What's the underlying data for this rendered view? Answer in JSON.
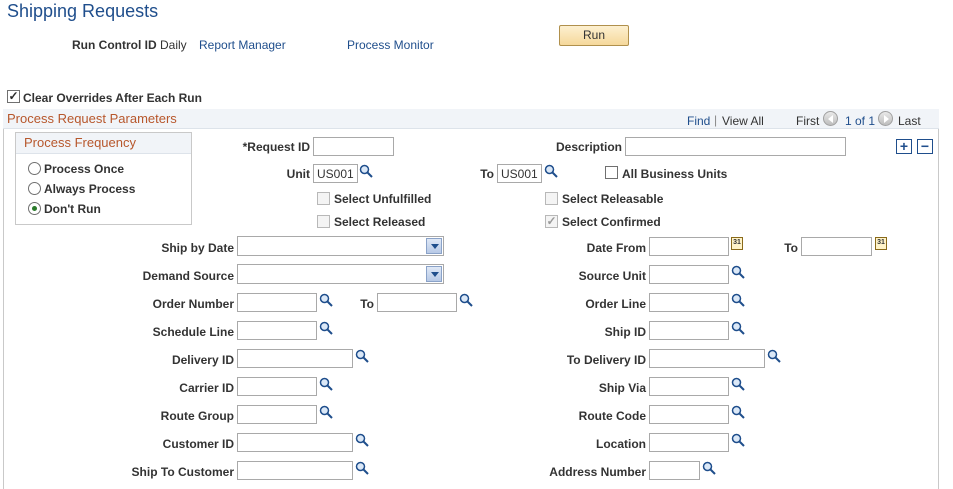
{
  "page": {
    "title": "Shipping Requests",
    "run_control_label": "Run Control ID",
    "run_control_value": "Daily",
    "report_manager": "Report Manager",
    "process_monitor": "Process Monitor",
    "run_button": "Run"
  },
  "clear_overrides": {
    "label": "Clear Overrides After Each Run",
    "checked": true
  },
  "params": {
    "title": "Process Request Parameters",
    "find": "Find",
    "view_all": "View All",
    "first": "First",
    "range": "1 of 1",
    "last": "Last",
    "add_icon": "plus-icon",
    "remove_icon": "minus-icon"
  },
  "frequency": {
    "title": "Process Frequency",
    "options": [
      "Process Once",
      "Always Process",
      "Don't Run"
    ],
    "selected": "Don't Run"
  },
  "fields": {
    "request_id": {
      "label": "*Request ID",
      "value": ""
    },
    "description": {
      "label": "Description",
      "value": ""
    },
    "unit": {
      "label": "Unit",
      "value": "US001"
    },
    "unit_to": {
      "label": "To",
      "value": "US001"
    },
    "all_business_units": {
      "label": "All Business Units",
      "checked": false
    },
    "select_unfulfilled": {
      "label": "Select Unfulfilled",
      "checked": false
    },
    "select_releasable": {
      "label": "Select Releasable",
      "checked": false
    },
    "select_released": {
      "label": "Select Released",
      "checked": false
    },
    "select_confirmed": {
      "label": "Select Confirmed",
      "checked": true
    },
    "ship_by_date": {
      "label": "Ship by Date",
      "value": ""
    },
    "date_from": {
      "label": "Date From",
      "value": ""
    },
    "date_to": {
      "label": "To",
      "value": ""
    },
    "demand_source": {
      "label": "Demand Source",
      "value": ""
    },
    "source_unit": {
      "label": "Source Unit",
      "value": ""
    },
    "order_number": {
      "label": "Order Number",
      "value": ""
    },
    "order_number_to": {
      "label": "To",
      "value": ""
    },
    "order_line": {
      "label": "Order Line",
      "value": ""
    },
    "schedule_line": {
      "label": "Schedule Line",
      "value": ""
    },
    "ship_id": {
      "label": "Ship ID",
      "value": ""
    },
    "delivery_id": {
      "label": "Delivery ID",
      "value": ""
    },
    "to_delivery_id": {
      "label": "To Delivery ID",
      "value": ""
    },
    "carrier_id": {
      "label": "Carrier ID",
      "value": ""
    },
    "ship_via": {
      "label": "Ship Via",
      "value": ""
    },
    "route_group": {
      "label": "Route Group",
      "value": ""
    },
    "route_code": {
      "label": "Route Code",
      "value": ""
    },
    "customer_id": {
      "label": "Customer ID",
      "value": ""
    },
    "location": {
      "label": "Location",
      "value": ""
    },
    "ship_to_customer": {
      "label": "Ship To Customer",
      "value": ""
    },
    "address_number": {
      "label": "Address Number",
      "value": ""
    }
  },
  "icons": {
    "lookup": "magnifier-icon",
    "calendar": "calendar-icon",
    "calendar_text": "31"
  },
  "colors": {
    "title_blue": "#1f4e8c",
    "section_orange": "#b7572c",
    "run_button": "#f5d89b"
  }
}
